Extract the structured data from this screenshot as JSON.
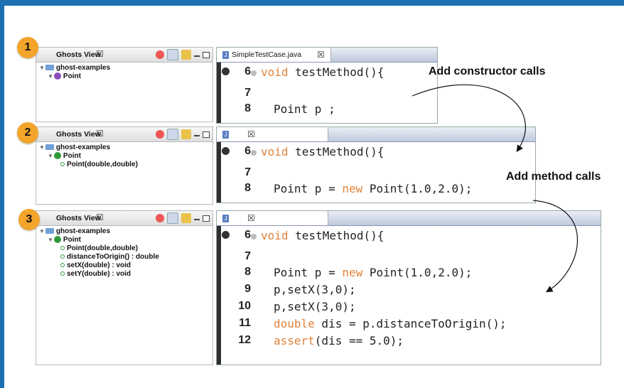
{
  "panels": [
    {
      "step": "1",
      "ghost_title": "Ghosts View",
      "close_glyph": "☒",
      "tree": [
        {
          "level": 0,
          "icon": "folder-icon",
          "text": "ghost-examples"
        },
        {
          "level": 1,
          "icon": "class-purple-icon",
          "text": "Point"
        }
      ],
      "editor_tab": "SimpleTestCase.java",
      "editor_close": "☒",
      "code": [
        {
          "num": "6",
          "segments": [
            {
              "t": "void",
              "kw": true
            },
            {
              "t": " testMethod(){",
              "kw": false
            }
          ]
        },
        {
          "num": "7",
          "segments": []
        },
        {
          "num": "8",
          "segments": [
            {
              "t": "Point p ;",
              "kw": false
            }
          ]
        }
      ]
    },
    {
      "step": "2",
      "ghost_title": "Ghosts View",
      "close_glyph": "☒",
      "tree": [
        {
          "level": 0,
          "icon": "folder-icon",
          "text": "ghost-examples"
        },
        {
          "level": 1,
          "icon": "class-green-icon",
          "text": "Point"
        },
        {
          "level": 2,
          "icon": "method-icon",
          "text": "Point(double,double)"
        }
      ],
      "editor_tab": "",
      "editor_close": "☒",
      "code": [
        {
          "num": "6",
          "segments": [
            {
              "t": "void",
              "kw": true
            },
            {
              "t": " testMethod(){",
              "kw": false
            }
          ]
        },
        {
          "num": "7",
          "segments": []
        },
        {
          "num": "8",
          "segments": [
            {
              "t": "Point p = ",
              "kw": false
            },
            {
              "t": "new",
              "kw": true
            },
            {
              "t": " Point(1.0,2.0);",
              "kw": false
            }
          ]
        }
      ]
    },
    {
      "step": "3",
      "ghost_title": "Ghosts View",
      "close_glyph": "☒",
      "tree": [
        {
          "level": 0,
          "icon": "folder-icon",
          "text": "ghost-examples"
        },
        {
          "level": 1,
          "icon": "class-green-icon",
          "text": "Point"
        },
        {
          "level": 2,
          "icon": "method-icon",
          "text": "Point(double,double)"
        },
        {
          "level": 2,
          "icon": "method-icon",
          "text": "distanceToOrigin() : double"
        },
        {
          "level": 2,
          "icon": "method-icon",
          "text": "setX(double) : void"
        },
        {
          "level": 2,
          "icon": "method-icon",
          "text": "setY(double) : void"
        }
      ],
      "editor_tab": "",
      "editor_close": "☒",
      "code": [
        {
          "num": "6",
          "segments": [
            {
              "t": "void",
              "kw": true
            },
            {
              "t": " testMethod(){",
              "kw": false
            }
          ]
        },
        {
          "num": "7",
          "segments": []
        },
        {
          "num": "8",
          "segments": [
            {
              "t": "Point p = ",
              "kw": false
            },
            {
              "t": "new",
              "kw": true
            },
            {
              "t": " Point(1.0,2.0);",
              "kw": false
            }
          ]
        },
        {
          "num": "9",
          "segments": [
            {
              "t": "p,setX(3,0);",
              "kw": false
            }
          ]
        },
        {
          "num": "10",
          "segments": [
            {
              "t": "p,setX(3,0);",
              "kw": false
            }
          ]
        },
        {
          "num": "11",
          "segments": [
            {
              "t": "double",
              "kw": true
            },
            {
              "t": " dis = p.distanceToOrigin();",
              "kw": false
            }
          ]
        },
        {
          "num": "12",
          "segments": [
            {
              "t": "assert",
              "kw": true
            },
            {
              "t": "(dis == 5.0);",
              "kw": false
            }
          ]
        }
      ]
    }
  ],
  "annotations": {
    "constructor_label": "Add constructor calls",
    "method_label": "Add method calls"
  },
  "colors": {
    "frame": "#1c6fb0",
    "badge": "#f2a52a",
    "keyword": "#e0823a"
  }
}
